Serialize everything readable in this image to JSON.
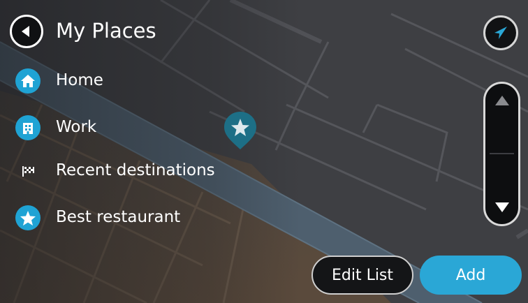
{
  "header": {
    "title": "My Places",
    "back_icon": "back-arrow-icon",
    "locate_icon": "current-location-arrow-icon"
  },
  "places": [
    {
      "label": "Home",
      "icon": "home-icon",
      "style": "round"
    },
    {
      "label": "Work",
      "icon": "work-building-icon",
      "style": "round"
    },
    {
      "label": "Recent destinations",
      "icon": "checkered-flag-icon",
      "style": "plain"
    },
    {
      "label": "Best restaurant",
      "icon": "star-icon",
      "style": "round"
    }
  ],
  "scroll": {
    "up_icon": "scroll-up-arrow-icon",
    "down_icon": "scroll-down-arrow-icon"
  },
  "actions": {
    "edit_list_label": "Edit List",
    "add_label": "Add"
  },
  "map": {
    "marker_icon": "star-pin-icon"
  },
  "colors": {
    "accent": "#2aa7d6",
    "icon_bg": "#1fa3d4",
    "map_pin": "#1d6f86",
    "background": "#3b3c40"
  }
}
